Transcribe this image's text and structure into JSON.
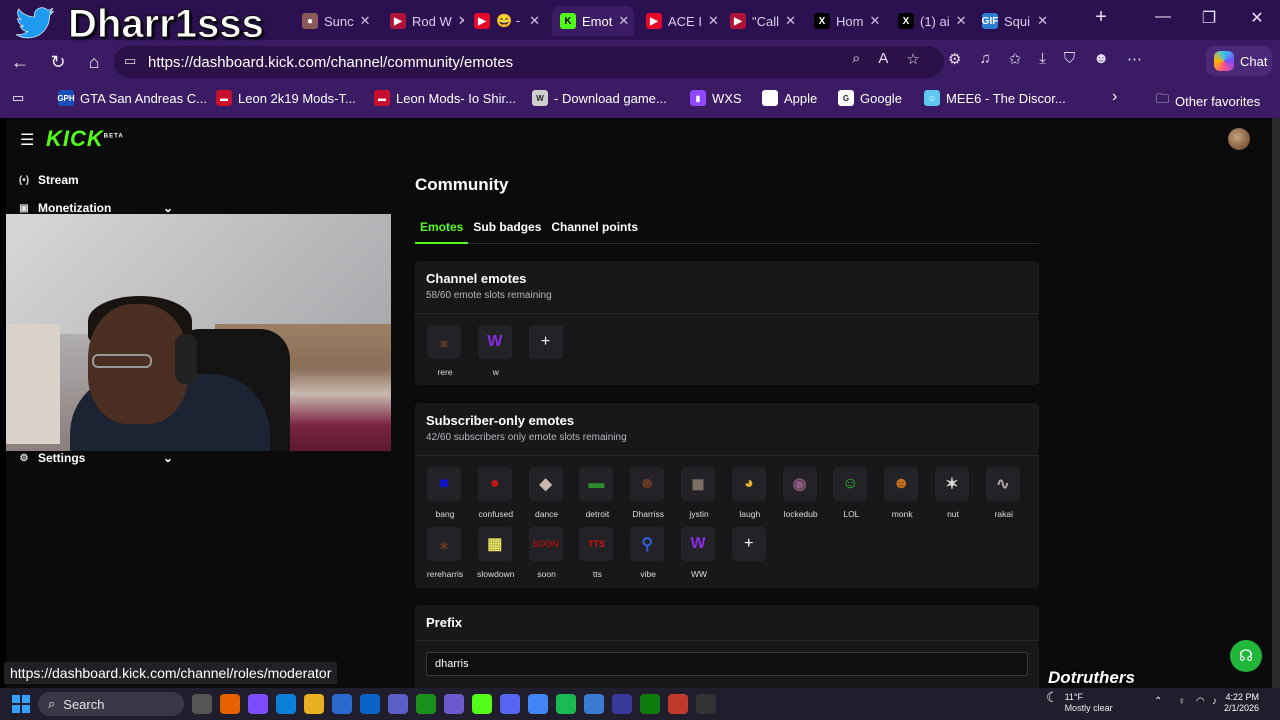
{
  "overlay": {
    "name": "Dharr1sss",
    "watermark": "Dotruthers"
  },
  "browser": {
    "tabs": [
      {
        "label": "Sunc",
        "fav_color": "#8a5a5a",
        "fav_glyph": "●",
        "active": false
      },
      {
        "label": "Rod W",
        "fav_color": "#b0133a",
        "fav_glyph": "▶",
        "active": false
      },
      {
        "label": "😄 -",
        "fav_color": "#e5092a",
        "fav_glyph": "▶",
        "active": false
      },
      {
        "label": "Emot",
        "fav_color": "#53fc18",
        "fav_glyph": "K",
        "active": true
      },
      {
        "label": "ACE I",
        "fav_color": "#e5092a",
        "fav_glyph": "▶",
        "active": false
      },
      {
        "label": "\"Call",
        "fav_color": "#b0133a",
        "fav_glyph": "▶",
        "active": false
      },
      {
        "label": "Hom",
        "fav_color": "#000000",
        "fav_glyph": "X",
        "active": false
      },
      {
        "label": "(1) ai",
        "fav_color": "#000000",
        "fav_glyph": "X",
        "active": false
      },
      {
        "label": "Squi",
        "fav_color": "#2d7fd6",
        "fav_glyph": "GIF",
        "active": false
      }
    ],
    "url": "https://dashboard.kick.com/channel/community/emotes",
    "chat_label": "Chat",
    "bookmarks": [
      {
        "label": "GTA San Andreas C...",
        "fav_color": "#1a4fb8",
        "fav_glyph": "GPH"
      },
      {
        "label": "Leon 2k19 Mods-T...",
        "fav_color": "#c8102e",
        "fav_glyph": "▬"
      },
      {
        "label": "Leon Mods- Io Shir...",
        "fav_color": "#c8102e",
        "fav_glyph": "▬"
      },
      {
        "label": "- Download game...",
        "fav_color": "#cfcfcf",
        "fav_glyph": "W"
      },
      {
        "label": "WXS",
        "fav_color": "#9146ff",
        "fav_glyph": "▮"
      },
      {
        "label": "Apple",
        "fav_color": "#ffffff",
        "fav_glyph": ""
      },
      {
        "label": "Google",
        "fav_color": "#ffffff",
        "fav_glyph": "G"
      },
      {
        "label": "MEE6 - The Discor...",
        "fav_color": "#5ec8f0",
        "fav_glyph": "☺"
      }
    ],
    "other_favorites": "Other favorites",
    "status_url": "https://dashboard.kick.com/channel/roles/moderator"
  },
  "kick": {
    "logo": "KICK",
    "logo_badge": "BETA",
    "brand_color": "#53fc18",
    "sidebar": [
      {
        "label": "Stream",
        "icon": "broadcast-icon",
        "glyph": "(•)",
        "expandable": false
      },
      {
        "label": "Monetization",
        "icon": "monetization-icon",
        "glyph": "▣",
        "expandable": true
      }
    ],
    "settings_label": "Settings"
  },
  "community": {
    "title": "Community",
    "tabs": [
      {
        "label": "Emotes",
        "active": true
      },
      {
        "label": "Sub badges",
        "active": false
      },
      {
        "label": "Channel points",
        "active": false
      }
    ],
    "channel_emotes": {
      "title": "Channel emotes",
      "subtitle": "58/60 emote slots remaining",
      "emotes": [
        {
          "name": "rere",
          "glyph": "⁎",
          "color": "#6b3a1e"
        },
        {
          "name": "w",
          "glyph": "W",
          "color": "#8a2be2"
        }
      ]
    },
    "subscriber_emotes": {
      "title": "Subscriber-only emotes",
      "subtitle": "42/60 subscribers only emote slots remaining",
      "emotes": [
        {
          "name": "bang",
          "glyph": "■",
          "color": "#1010d0"
        },
        {
          "name": "confused",
          "glyph": "●",
          "color": "#c01818"
        },
        {
          "name": "dance",
          "glyph": "◆",
          "color": "#c9b8b0"
        },
        {
          "name": "detroit",
          "glyph": "▬",
          "color": "#2e8b2e"
        },
        {
          "name": "Dharriss",
          "glyph": "☻",
          "color": "#6a3a22"
        },
        {
          "name": "jystin",
          "glyph": "◼",
          "color": "#7d6e64"
        },
        {
          "name": "laugh",
          "glyph": "◕",
          "color": "#e0b030"
        },
        {
          "name": "lockedub",
          "glyph": "◉",
          "color": "#8a5a7a"
        },
        {
          "name": "LOL",
          "glyph": "☺",
          "color": "#2fbf2f"
        },
        {
          "name": "monk",
          "glyph": "☻",
          "color": "#c87020"
        },
        {
          "name": "nut",
          "glyph": "✶",
          "color": "#d8d8d8"
        },
        {
          "name": "rakai",
          "glyph": "∿",
          "color": "#b0a8a8"
        },
        {
          "name": "rereharris",
          "glyph": "⁎",
          "color": "#6b3a1e"
        },
        {
          "name": "slowdown",
          "glyph": "▦",
          "color": "#e8e060"
        },
        {
          "name": "soon",
          "glyph": "SOON",
          "color": "#a01010"
        },
        {
          "name": "tts",
          "glyph": "TTS",
          "color": "#d01010"
        },
        {
          "name": "vibe",
          "glyph": "⚲",
          "color": "#3060e0"
        },
        {
          "name": "WW",
          "glyph": "W",
          "color": "#8a2be2"
        }
      ]
    },
    "prefix": {
      "title": "Prefix",
      "value": "dharris"
    }
  },
  "taskbar": {
    "search_label": "Search",
    "weather_temp": "11°F",
    "weather_desc": "Mostly clear",
    "time": "4:22 PM",
    "date": "2/1/2026",
    "apps": [
      {
        "name": "task-view-icon",
        "color": "#555"
      },
      {
        "name": "firefox-icon",
        "color": "#e66000"
      },
      {
        "name": "copilot-icon",
        "color": "#7c4dff"
      },
      {
        "name": "edge-icon",
        "color": "#0c7fd9"
      },
      {
        "name": "file-explorer-icon",
        "color": "#e8b020"
      },
      {
        "name": "store-icon",
        "color": "#2b6bd0"
      },
      {
        "name": "outlook-icon",
        "color": "#0a64c8"
      },
      {
        "name": "teams-icon",
        "color": "#5b5fc7"
      },
      {
        "name": "xbox-app-icon",
        "color": "#1b8f1b"
      },
      {
        "name": "notes-icon",
        "color": "#6a5acd"
      },
      {
        "name": "kick-app-icon",
        "color": "#53fc18"
      },
      {
        "name": "discord-icon",
        "color": "#5865f2"
      },
      {
        "name": "chrome-icon",
        "color": "#4285f4"
      },
      {
        "name": "spotify-icon",
        "color": "#1db954"
      },
      {
        "name": "monitor-icon",
        "color": "#3a7bd5"
      },
      {
        "name": "phone-link-icon",
        "color": "#3a3a9a"
      },
      {
        "name": "xbox-icon",
        "color": "#107c10"
      },
      {
        "name": "game-icon",
        "color": "#c0392b"
      },
      {
        "name": "obs-icon",
        "color": "#333"
      }
    ]
  }
}
